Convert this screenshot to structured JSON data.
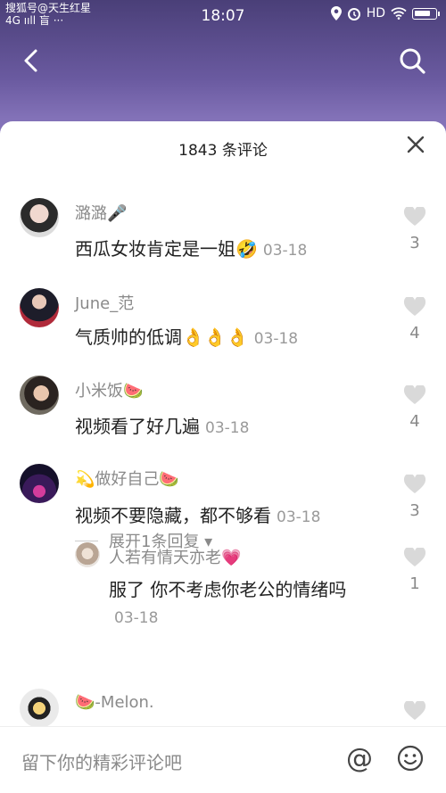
{
  "watermark": "搜狐号@天生红星",
  "status": {
    "net": "4G ııll 盲 ···",
    "time": "18:07",
    "hd": "HD"
  },
  "sheet": {
    "title": "1843 条评论"
  },
  "comments": [
    {
      "name": "潞潞🎤",
      "text": "西瓜女妆肯定是一姐🤣",
      "date": "03-18",
      "likes": "3"
    },
    {
      "name": "June_范",
      "text": "气质帅的低调👌👌👌",
      "date": "03-18",
      "likes": "4"
    },
    {
      "name": "小米饭🍉",
      "text": "视频看了好几遍",
      "date": "03-18",
      "likes": "4"
    },
    {
      "name": "💫做好自己🍉",
      "text": "视频不要隐藏，都不够看",
      "date": "03-18",
      "likes": "3"
    },
    {
      "name": "🍉-Melon.",
      "text": "",
      "date": "",
      "likes": ""
    }
  ],
  "reply": {
    "name": "人若有情天亦老💗",
    "text": "服了 你不考虑你老公的情绪吗",
    "date": "03-18",
    "likes": "1"
  },
  "expand": {
    "label": "展开1条回复 ▾"
  },
  "input": {
    "placeholder": "留下你的精彩评论吧",
    "at": "@"
  },
  "colors": {
    "accent_bg": "#8372b8",
    "text_main": "#222222",
    "text_muted": "#8a8a8a",
    "like_icon": "#d9d9d9"
  }
}
